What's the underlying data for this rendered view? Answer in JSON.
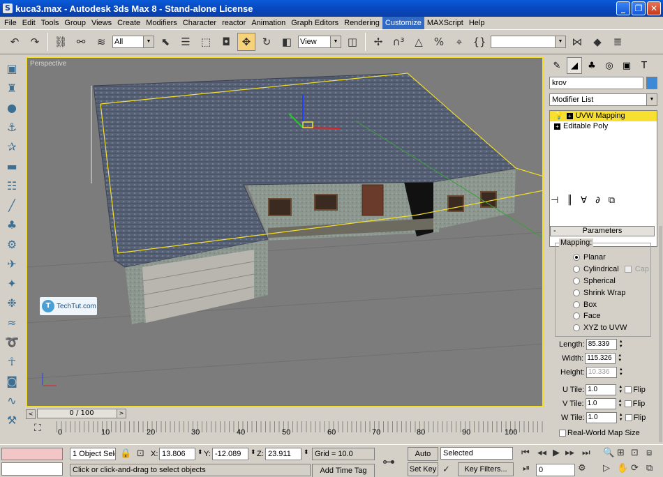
{
  "window": {
    "title": "kuca3.max - Autodesk 3ds Max 8   - Stand-alone License",
    "min": "_",
    "max": "❐",
    "close": "✕"
  },
  "menu": [
    "File",
    "Edit",
    "Tools",
    "Group",
    "Views",
    "Create",
    "Modifiers",
    "Character",
    "reactor",
    "Animation",
    "Graph Editors",
    "Rendering",
    "Customize",
    "MAXScript",
    "Help"
  ],
  "toolbar": {
    "selection_filter": "All",
    "ref_coord": "View",
    "named_selection": ""
  },
  "viewport": {
    "label": "Perspective",
    "watermark": "TechTut.com"
  },
  "timeslider": {
    "frame": "0 / 100",
    "left_arrow": "<",
    "right_arrow": ">"
  },
  "track": {
    "ticks": [
      "0",
      "10",
      "20",
      "30",
      "40",
      "50",
      "60",
      "70",
      "80",
      "90",
      "100"
    ]
  },
  "command_panel": {
    "object_name": "krov",
    "modifier_list": "Modifier List",
    "stack": [
      "UVW Mapping",
      "Editable Poly"
    ],
    "rollout_title": "Parameters",
    "rollout_toggle": "-",
    "mapping_label": "Mapping:",
    "mapping_options": [
      "Planar",
      "Cylindrical",
      "Spherical",
      "Shrink Wrap",
      "Box",
      "Face",
      "XYZ to UVW"
    ],
    "cap_label": "Cap",
    "length_label": "Length:",
    "length": "85.339",
    "width_label": "Width:",
    "width": "115.326",
    "height_label": "Height:",
    "height": "10.336",
    "utile_label": "U Tile:",
    "utile": "1.0",
    "vtile_label": "V Tile:",
    "vtile": "1.0",
    "wtile_label": "W Tile:",
    "wtile": "1.0",
    "flip_label": "Flip",
    "real_world_label": "Real-World Map Size"
  },
  "status": {
    "selection_count": "1 Object Sele",
    "x_label": "X:",
    "x": "13.806",
    "y_label": "Y:",
    "y": "-12.089",
    "z_label": "Z:",
    "z": "23.911",
    "grid": "Grid = 10.0",
    "prompt": "Click or click-and-drag to select objects",
    "add_time_tag": "Add Time Tag",
    "auto_key": "Auto Key",
    "set_key": "Set Key",
    "key_mode": "Selected",
    "key_filters": "Key Filters...",
    "current_frame": "0"
  }
}
